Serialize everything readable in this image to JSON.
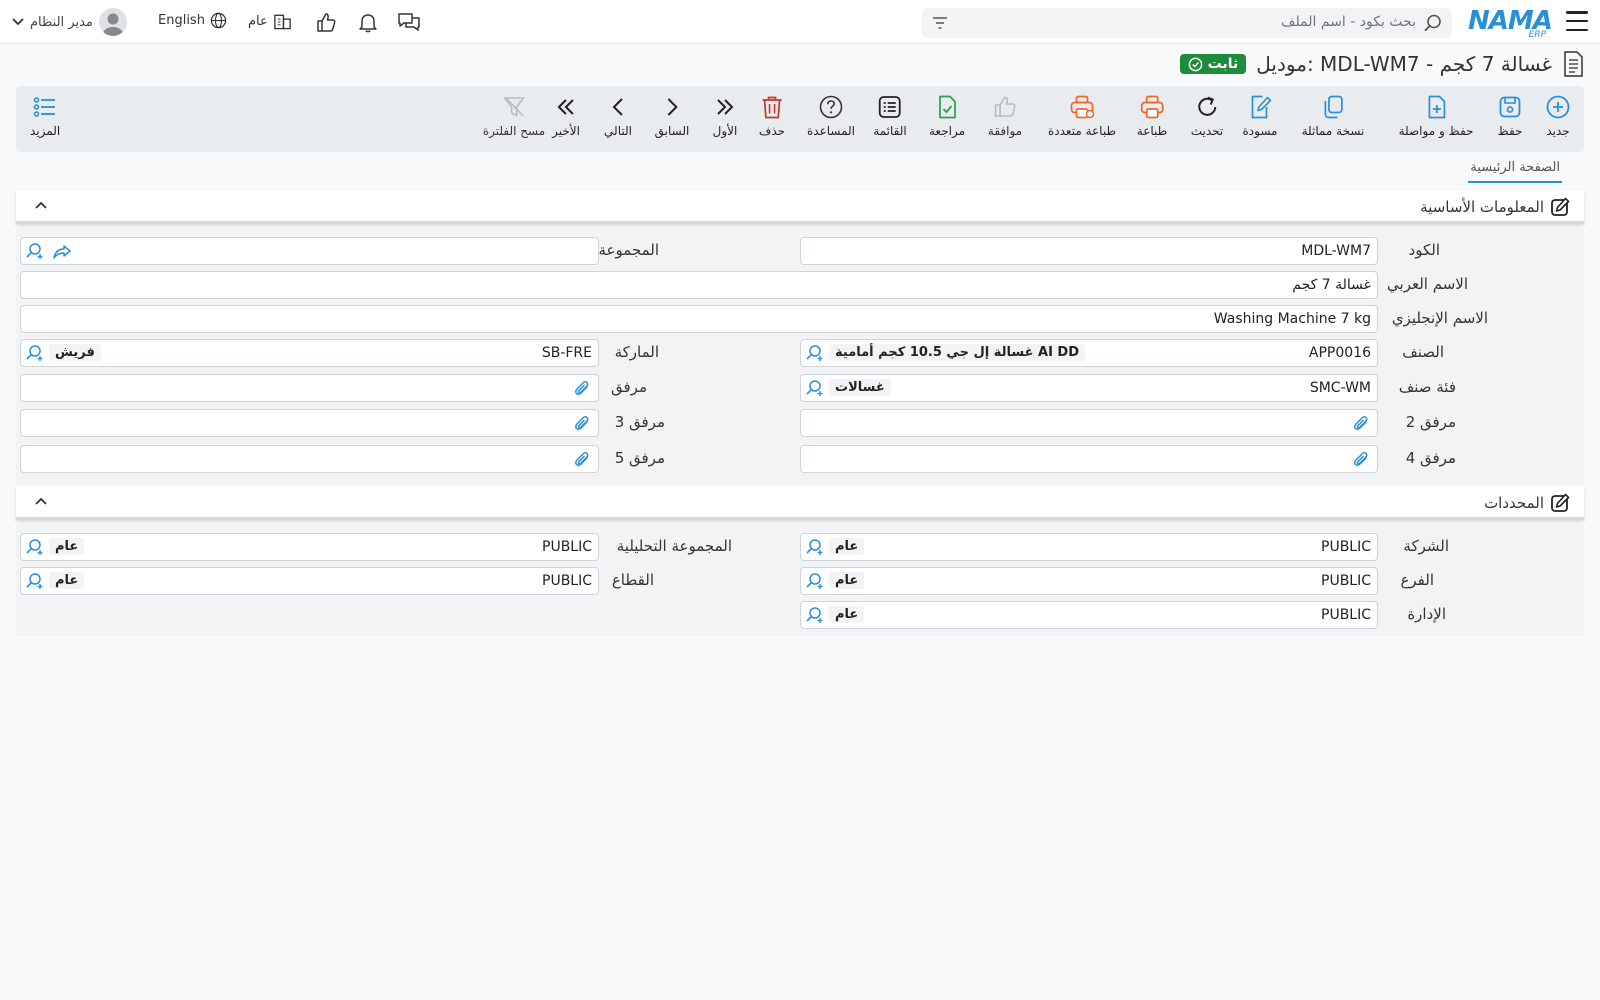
{
  "app": {
    "logo_text": "NAMA",
    "logo_sub": "ERP",
    "search_placeholder": "بحث بكود - اسم الملف",
    "user_name": "مدير النظام",
    "language": "English",
    "company": "عام"
  },
  "page": {
    "title": "موديل: MDL-WM7 - غسالة 7 كجم",
    "status_badge": "ثابت"
  },
  "toolbar": {
    "new": "جديد",
    "save": "حفظ",
    "save_continue": "حفظ و مواصلة",
    "duplicate": "نسخة مماثلة",
    "draft": "مسودة",
    "refresh": "تحديث",
    "print": "طباعة",
    "multi_print": "طباعة متعددة",
    "approve": "موافقة",
    "review": "مراجعة",
    "list": "القائمة",
    "help": "المساعدة",
    "delete": "حذف",
    "first": "الأول",
    "previous": "السابق",
    "next": "التالي",
    "last": "الأخير",
    "clear_filter": "مسح الفلترة",
    "more": "المزيد"
  },
  "tabs": {
    "main": "الصفحة الرئيسية"
  },
  "basic": {
    "title": "المعلومات الأساسية",
    "code_label": "الكود",
    "code_value": "MDL-WM7",
    "group_label": "المجموعة",
    "arabic_name_label": "الاسم العربي",
    "arabic_name_value": "غسالة 7 كجم",
    "english_name_label": "الاسم الإنجليزي",
    "english_name_value": "Washing Machine 7 kg",
    "item_label": "الصنف",
    "item_code": "APP0016",
    "item_name": "غسالة إل جي 10.5 كجم أمامية AI DD",
    "brand_label": "الماركة",
    "brand_code": "SB-FRE",
    "brand_name": "فريش",
    "item_category_label": "فئة صنف",
    "item_category_code": "SMC-WM",
    "item_category_name": "غسالات",
    "attachment_label": "مرفق",
    "attachment2_label": "مرفق 2",
    "attachment3_label": "مرفق 3",
    "attachment4_label": "مرفق 4",
    "attachment5_label": "مرفق 5"
  },
  "dimensions": {
    "title": "المحددات",
    "company_label": "الشركة",
    "company_code": "PUBLIC",
    "company_name": "عام",
    "analytic_group_label": "المجموعة التحليلية",
    "analytic_group_code": "PUBLIC",
    "analytic_group_name": "عام",
    "branch_label": "الفرع",
    "branch_code": "PUBLIC",
    "branch_name": "عام",
    "sector_label": "القطاع",
    "sector_code": "PUBLIC",
    "sector_name": "عام",
    "department_label": "الإدارة",
    "department_code": "PUBLIC",
    "department_name": "عام"
  },
  "colors": {
    "accent": "#2b8fd6",
    "badge": "#1e8c3a",
    "print_orange": "#f26522",
    "delete_red": "#c0392b",
    "review_green": "#2e9e4f"
  }
}
